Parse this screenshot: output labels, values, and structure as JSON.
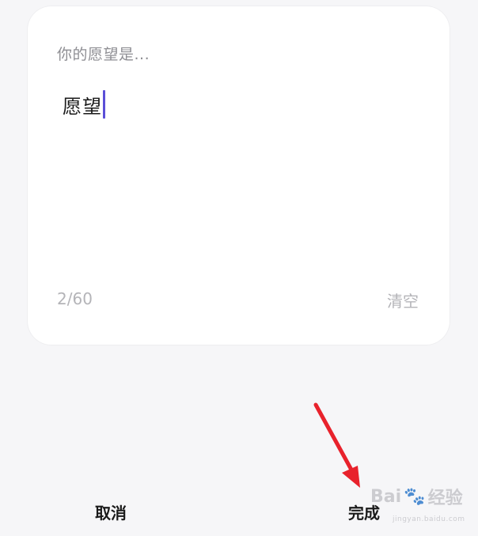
{
  "editor": {
    "placeholder": "你的愿望是...",
    "value": "愿望",
    "counter": "2/60",
    "clear_label": "清空",
    "cursor_color": "#5b4fd8"
  },
  "footer": {
    "cancel_label": "取消",
    "done_label": "完成"
  },
  "annotation": {
    "arrow_color": "#e8222c"
  },
  "watermark": {
    "brand_left": "Bai",
    "brand_right": "经验",
    "url": "jingyan.baidu.com"
  }
}
